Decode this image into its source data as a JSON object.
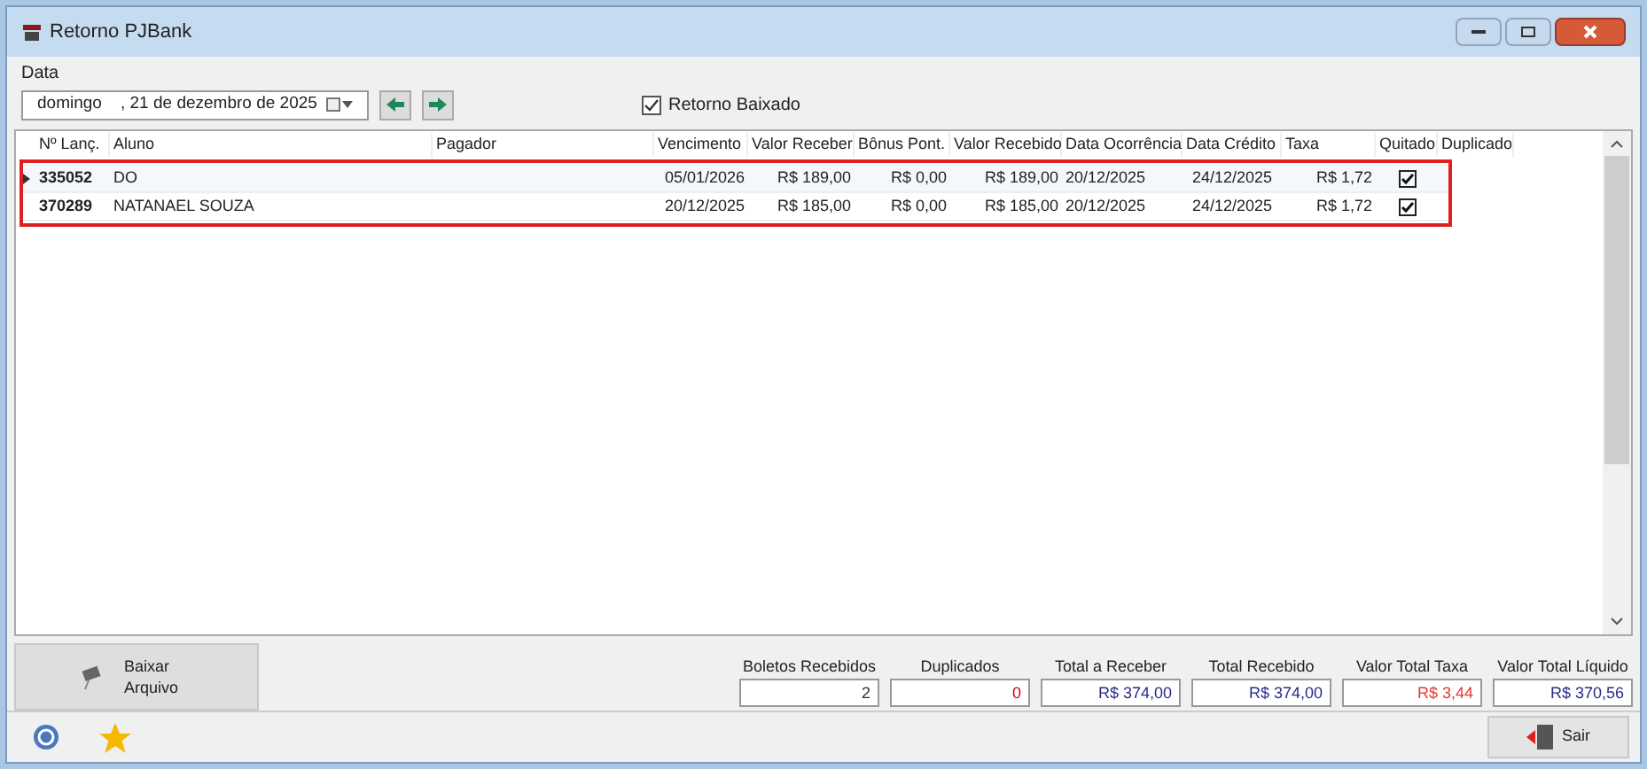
{
  "window": {
    "title": "Retorno PJBank"
  },
  "date": {
    "label": "Data",
    "value": "domingo    , 21 de dezembro de 2025"
  },
  "retorno_baixado": {
    "label": "Retorno Baixado",
    "checked": true
  },
  "table": {
    "columns": [
      "Nº Lanç.",
      "Aluno",
      "Pagador",
      "Vencimento",
      "Valor Receber",
      "Bônus Pont.",
      "Valor Recebido",
      "Data Ocorrência",
      "Data Crédito",
      "Taxa",
      "Quitado",
      "Duplicado"
    ],
    "rows": [
      {
        "selected": true,
        "cells": [
          "335052",
          "DO",
          "",
          "05/01/2026",
          "R$ 189,00",
          "R$ 0,00",
          "R$ 189,00",
          "20/12/2025",
          "24/12/2025",
          "R$ 1,72"
        ],
        "quitado": true
      },
      {
        "selected": false,
        "cells": [
          "370289",
          "NATANAEL SOUZA",
          "",
          "20/12/2025",
          "R$ 185,00",
          "R$ 0,00",
          "R$ 185,00",
          "20/12/2025",
          "24/12/2025",
          "R$ 1,72"
        ],
        "quitado": true
      }
    ]
  },
  "download_button": {
    "label": "Baixar Arquivo"
  },
  "totals": [
    {
      "label": "Boletos Recebidos",
      "value": "2",
      "color": "#333333"
    },
    {
      "label": "Duplicados",
      "value": "0",
      "color": "#d0021b"
    },
    {
      "label": "Total a Receber",
      "value": "R$ 374,00",
      "color": "#2b2b8c"
    },
    {
      "label": "Total Recebido",
      "value": "R$ 374,00",
      "color": "#2b2b8c"
    },
    {
      "label": "Valor Total Taxa",
      "value": "R$ 3,44",
      "color": "#e53935"
    },
    {
      "label": "Valor Total Líquido",
      "value": "R$ 370,56",
      "color": "#2b2b8c"
    }
  ],
  "exit_button": {
    "label": "Sair"
  }
}
